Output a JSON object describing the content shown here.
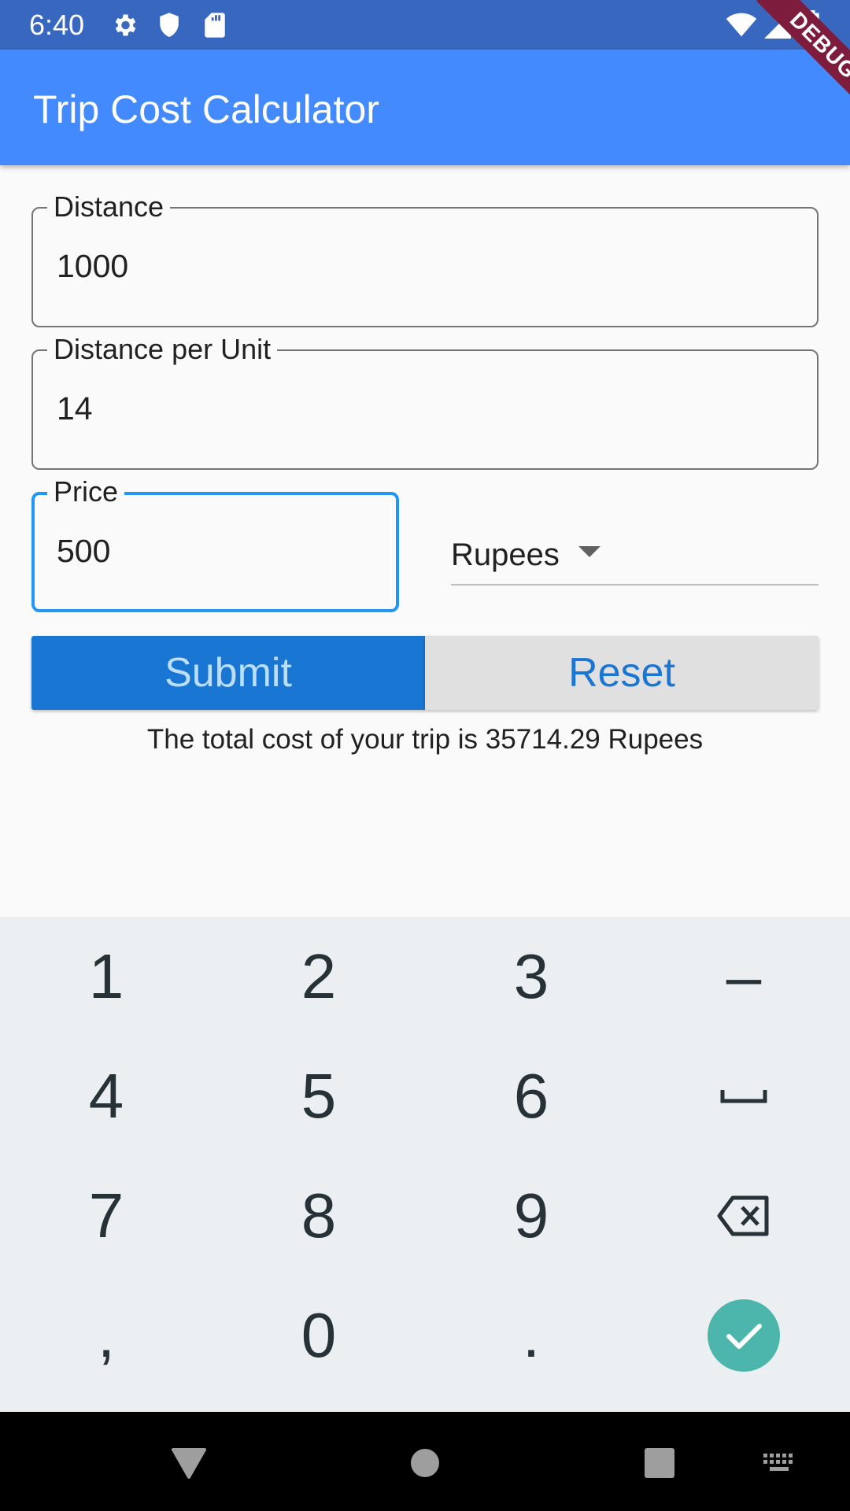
{
  "status_bar": {
    "time": "6:40",
    "left_icons": [
      "gear-icon",
      "shield-icon",
      "sd-card-icon"
    ],
    "right_icons": [
      "wifi-icon",
      "cell-signal-icon",
      "battery-charging-icon"
    ]
  },
  "debug_banner": "DEBUG",
  "app_bar": {
    "title": "Trip Cost Calculator",
    "color": "#448aff"
  },
  "form": {
    "distance": {
      "label": "Distance",
      "value": "1000"
    },
    "distance_per_unit": {
      "label": "Distance per Unit",
      "value": "14"
    },
    "price": {
      "label": "Price",
      "value": "500",
      "focused": true
    },
    "currency": {
      "selected": "Rupees"
    }
  },
  "buttons": {
    "submit": "Submit",
    "reset": "Reset",
    "submit_color": "#1976d2"
  },
  "result_text": "The total cost of your trip is 35714.29 Rupees",
  "keyboard": {
    "rows": [
      [
        "1",
        "2",
        "3",
        "–"
      ],
      [
        "4",
        "5",
        "6",
        "space-icon"
      ],
      [
        "7",
        "8",
        "9",
        "backspace-icon"
      ],
      [
        ",",
        "0",
        ".",
        "check-icon"
      ]
    ],
    "accent": "#4db6ac"
  },
  "nav_bar": {
    "icons": [
      "back-triangle-icon",
      "home-circle-icon",
      "recents-square-icon",
      "keyboard-switch-icon"
    ]
  }
}
